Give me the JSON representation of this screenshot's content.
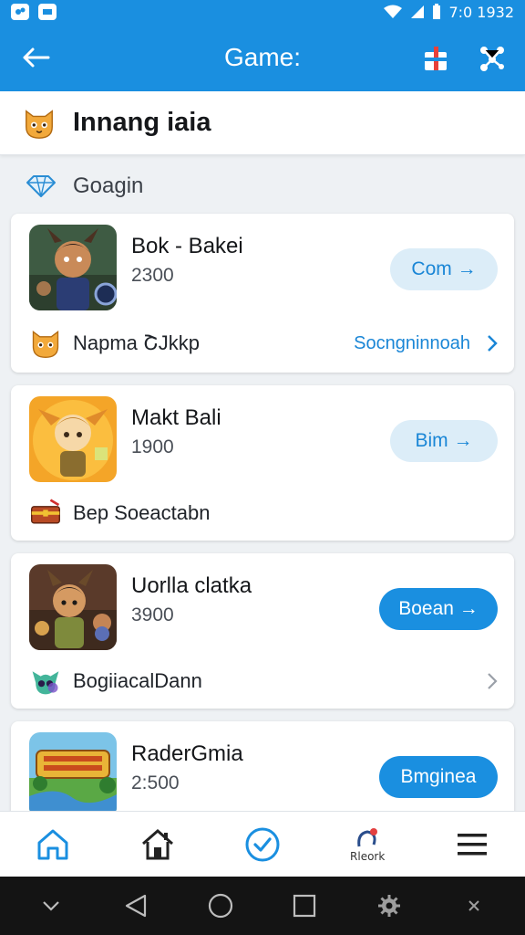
{
  "status_bar": {
    "time": "7:0 1932",
    "icons": [
      "app-icon",
      "message-icon",
      "wifi-icon",
      "signal-icon",
      "battery-icon"
    ]
  },
  "app_bar": {
    "title": "Game:",
    "icons": [
      "back-arrow-icon",
      "gift-box-icon",
      "share-icon"
    ]
  },
  "section": {
    "title": "Innang iaia",
    "icon": "cat-face-icon"
  },
  "subsection": {
    "title": "Goagin",
    "icon": "diamond-icon"
  },
  "games": [
    {
      "name": "Bok - Bakei",
      "score": "2300",
      "button": "Com →",
      "button_style": "light",
      "sub_icon": "cat-face-icon",
      "sub_label": "Napma ՇJkkp",
      "sub_link": "Socngninnoah",
      "sub_action": "chevron-right-icon"
    },
    {
      "name": "Makt Bali",
      "score": "1900",
      "button": "Bim →",
      "button_style": "light",
      "sub_icon": "treasure-chest-icon",
      "sub_label": "Bep Soeactabn",
      "sub_link": "",
      "sub_action": ""
    },
    {
      "name": "Uorlla clatka",
      "score": "3900",
      "button": "Boean →",
      "button_style": "solid",
      "sub_icon": "alien-head-icon",
      "sub_label": "BogiiacalDann",
      "sub_link": "",
      "sub_action": "chevron-right-icon"
    },
    {
      "name": "RaderGmia",
      "score": "2:500",
      "button": "Bmginea",
      "button_style": "solid",
      "sub_icon": "",
      "sub_label": "",
      "sub_link": "",
      "sub_action": ""
    }
  ],
  "bottom_nav": {
    "items": [
      {
        "icon": "home-outline-icon",
        "label": ""
      },
      {
        "icon": "house-icon",
        "label": ""
      },
      {
        "icon": "check-circle-icon",
        "label": ""
      },
      {
        "icon": "notification-icon",
        "label": "Rleork"
      },
      {
        "icon": "menu-icon",
        "label": ""
      }
    ]
  },
  "system_nav": {
    "icons": [
      "chevron-down-icon",
      "back-triangle-icon",
      "home-circle-icon",
      "recents-square-icon",
      "settings-gear-icon",
      "close-icon"
    ]
  },
  "colors": {
    "primary": "#1a8fe0",
    "light_button": "#dcedf8",
    "link": "#1a86d6",
    "background": "#eef1f4"
  }
}
